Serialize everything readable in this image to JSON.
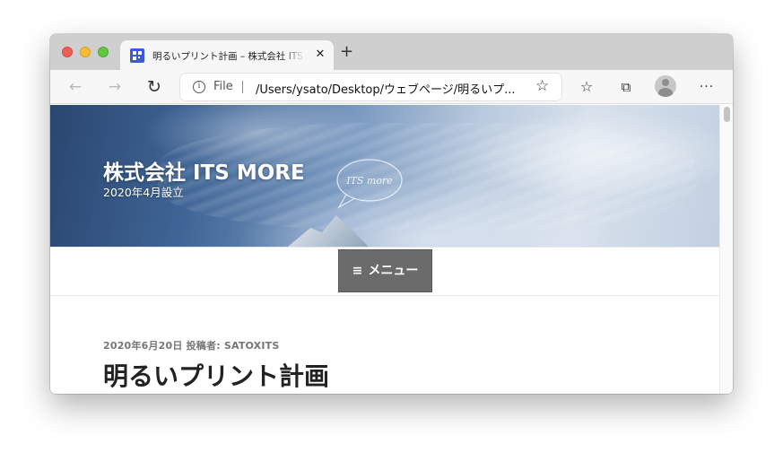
{
  "browser": {
    "tab": {
      "title": "明るいプリント計画 – 株式会社 ITS MORE",
      "close_glyph": "✕"
    },
    "new_tab_glyph": "+",
    "toolbar": {
      "back_glyph": "←",
      "forward_glyph": "→",
      "reload_glyph": "↻",
      "info_glyph": "i",
      "scheme": "File",
      "url": "/Users/ysato/Desktop/ウェブページ/明るいプ...",
      "favorite_glyph": "☆",
      "favorites_glyph": "☆",
      "collections_glyph": "⧉",
      "more_glyph": "···"
    }
  },
  "site": {
    "title": "株式会社 ITS MORE",
    "tagline": "2020年4月設立",
    "bubble_text": "ITS more",
    "menu_label": "メニュー",
    "menu_icon": "≡"
  },
  "post": {
    "meta": "2020年6月20日 投稿者: SATOXITS",
    "title": "明るいプリント計画"
  },
  "colors": {
    "menu_button": "#6b6b6b",
    "title_text": "#222222",
    "meta_text": "#767676"
  }
}
